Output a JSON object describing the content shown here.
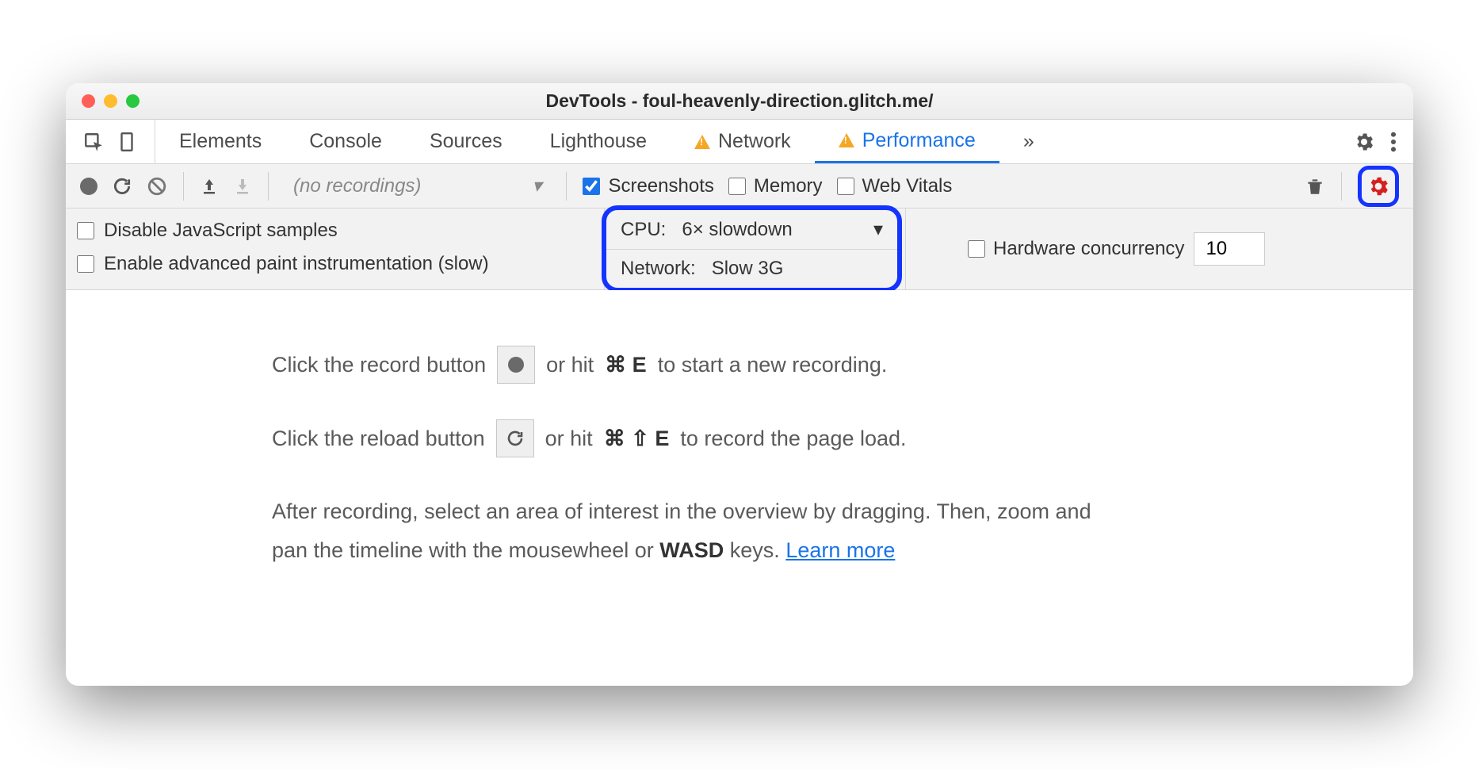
{
  "window": {
    "title": "DevTools - foul-heavenly-direction.glitch.me/"
  },
  "tabs": {
    "elements": "Elements",
    "console": "Console",
    "sources": "Sources",
    "lighthouse": "Lighthouse",
    "network": "Network",
    "performance": "Performance",
    "more": "»"
  },
  "toolbar": {
    "no_recordings": "(no recordings)",
    "screenshots": "Screenshots",
    "memory": "Memory",
    "webvitals": "Web Vitals"
  },
  "settings": {
    "disable_js": "Disable JavaScript samples",
    "paint_instr": "Enable advanced paint instrumentation (slow)",
    "cpu_label": "CPU:",
    "cpu_value": "6× slowdown",
    "net_label": "Network:",
    "net_value": "Slow 3G",
    "hw_label": "Hardware concurrency",
    "hw_value": "10"
  },
  "hints": {
    "l1a": "Click the record button",
    "l1b": "or hit",
    "l1key": "⌘ E",
    "l1c": "to start a new recording.",
    "l2a": "Click the reload button",
    "l2b": "or hit",
    "l2key": "⌘ ⇧ E",
    "l2c": "to record the page load.",
    "l3a": "After recording, select an area of interest in the overview by dragging. Then, zoom and pan the timeline with the mousewheel or ",
    "l3b": "WASD",
    "l3c": " keys. ",
    "learn": "Learn more"
  }
}
